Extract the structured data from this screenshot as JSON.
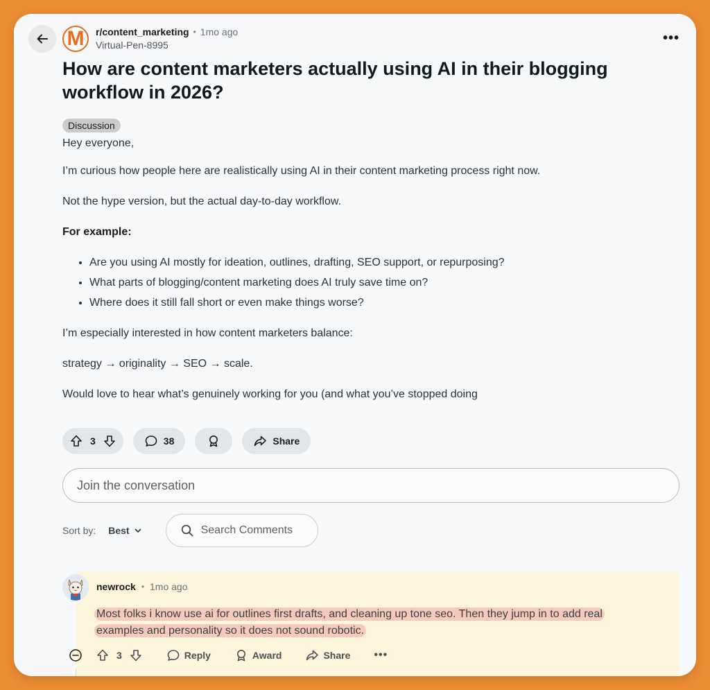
{
  "header": {
    "subreddit": "r/content_marketing",
    "separator": "•",
    "time": "1mo ago",
    "username": "Virtual-Pen-8995",
    "avatar_letter": "M",
    "more_label": "•••"
  },
  "post": {
    "title": "How are content marketers actually using AI in their blogging workflow in 2026?",
    "flair": "Discussion",
    "paragraphs": {
      "p1": "Hey everyone,",
      "p2": "I’m curious how people here are realistically using AI in their content marketing process right now.",
      "p3": "Not the hype version, but the actual day-to-day workflow.",
      "p4": "For example:",
      "bullets": [
        "Are you using AI mostly for ideation, outlines, drafting, SEO support, or repurposing?",
        "What parts of blogging/content marketing does AI truly save time on?",
        "Where does it still fall short or even make things worse?"
      ],
      "p5": "I’m especially interested in how content marketers balance:",
      "p6": "strategy → originality → SEO → scale.",
      "p7": "Would love to hear what’s genuinely working for you (and what you’ve stopped doing"
    }
  },
  "actions": {
    "votes": "3",
    "comments": "38",
    "share_label": "Share"
  },
  "join": {
    "placeholder": "Join the conversation"
  },
  "sort": {
    "label": "Sort by:",
    "value": "Best",
    "search_placeholder": "Search Comments"
  },
  "comment": {
    "author": "newrock",
    "separator": "•",
    "time": "1mo ago",
    "text_line1": "Most folks i know use ai for outlines first drafts, and cleaning up tone seo. Then they jump in to add real",
    "text_line2": "examples and personality so it does not sound robotic.",
    "votes": "3",
    "reply_label": "Reply",
    "award_label": "Award",
    "share_label": "Share",
    "more_label": "•••",
    "highlight_color": "#f6c9bd",
    "background_color": "#fdf6dc"
  },
  "colors": {
    "page_background": "#EE8E34",
    "card_background": "#f7f8fa",
    "pill_background": "#e3e6e8"
  }
}
